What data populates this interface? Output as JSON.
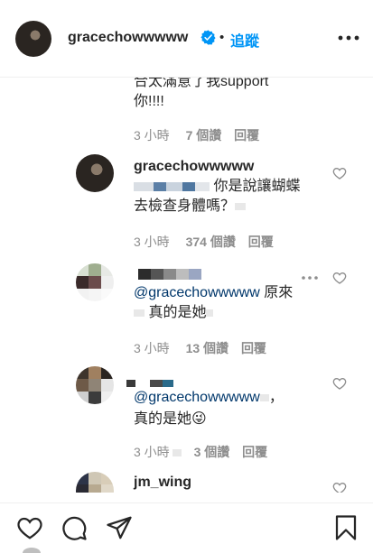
{
  "header": {
    "username": "gracechowwwww",
    "dot": "•",
    "follow_label": "追蹤",
    "verified_color": "#0095f6"
  },
  "comments": [
    {
      "text_lines": [
        "合太滿意了我support",
        "你!!!!"
      ],
      "time": "3 小時",
      "likes": "7 個讚",
      "reply": "回覆"
    },
    {
      "username": "gracechowwwww",
      "text_lines": [
        "你是說讓蝴蝶",
        "去檢查身體嗎？"
      ],
      "time": "3 小時",
      "likes": "374 個讚",
      "reply": "回覆"
    },
    {
      "mention": "@gracechowwwww",
      "text_after_mention": " 原來",
      "text_line2": "真的是她",
      "time": "3 小時",
      "likes": "13 個讚",
      "reply": "回覆"
    },
    {
      "mention": "@gracechowwwww",
      "text_after_mention": "，",
      "text_line2": "真的是她😜",
      "time": "3 小時",
      "likes": "3 個讚",
      "reply": "回覆"
    },
    {
      "username": "jm_wing"
    }
  ],
  "icons": {
    "like": "heart-icon",
    "comment": "comment-icon",
    "share": "share-icon",
    "save": "bookmark-icon"
  }
}
